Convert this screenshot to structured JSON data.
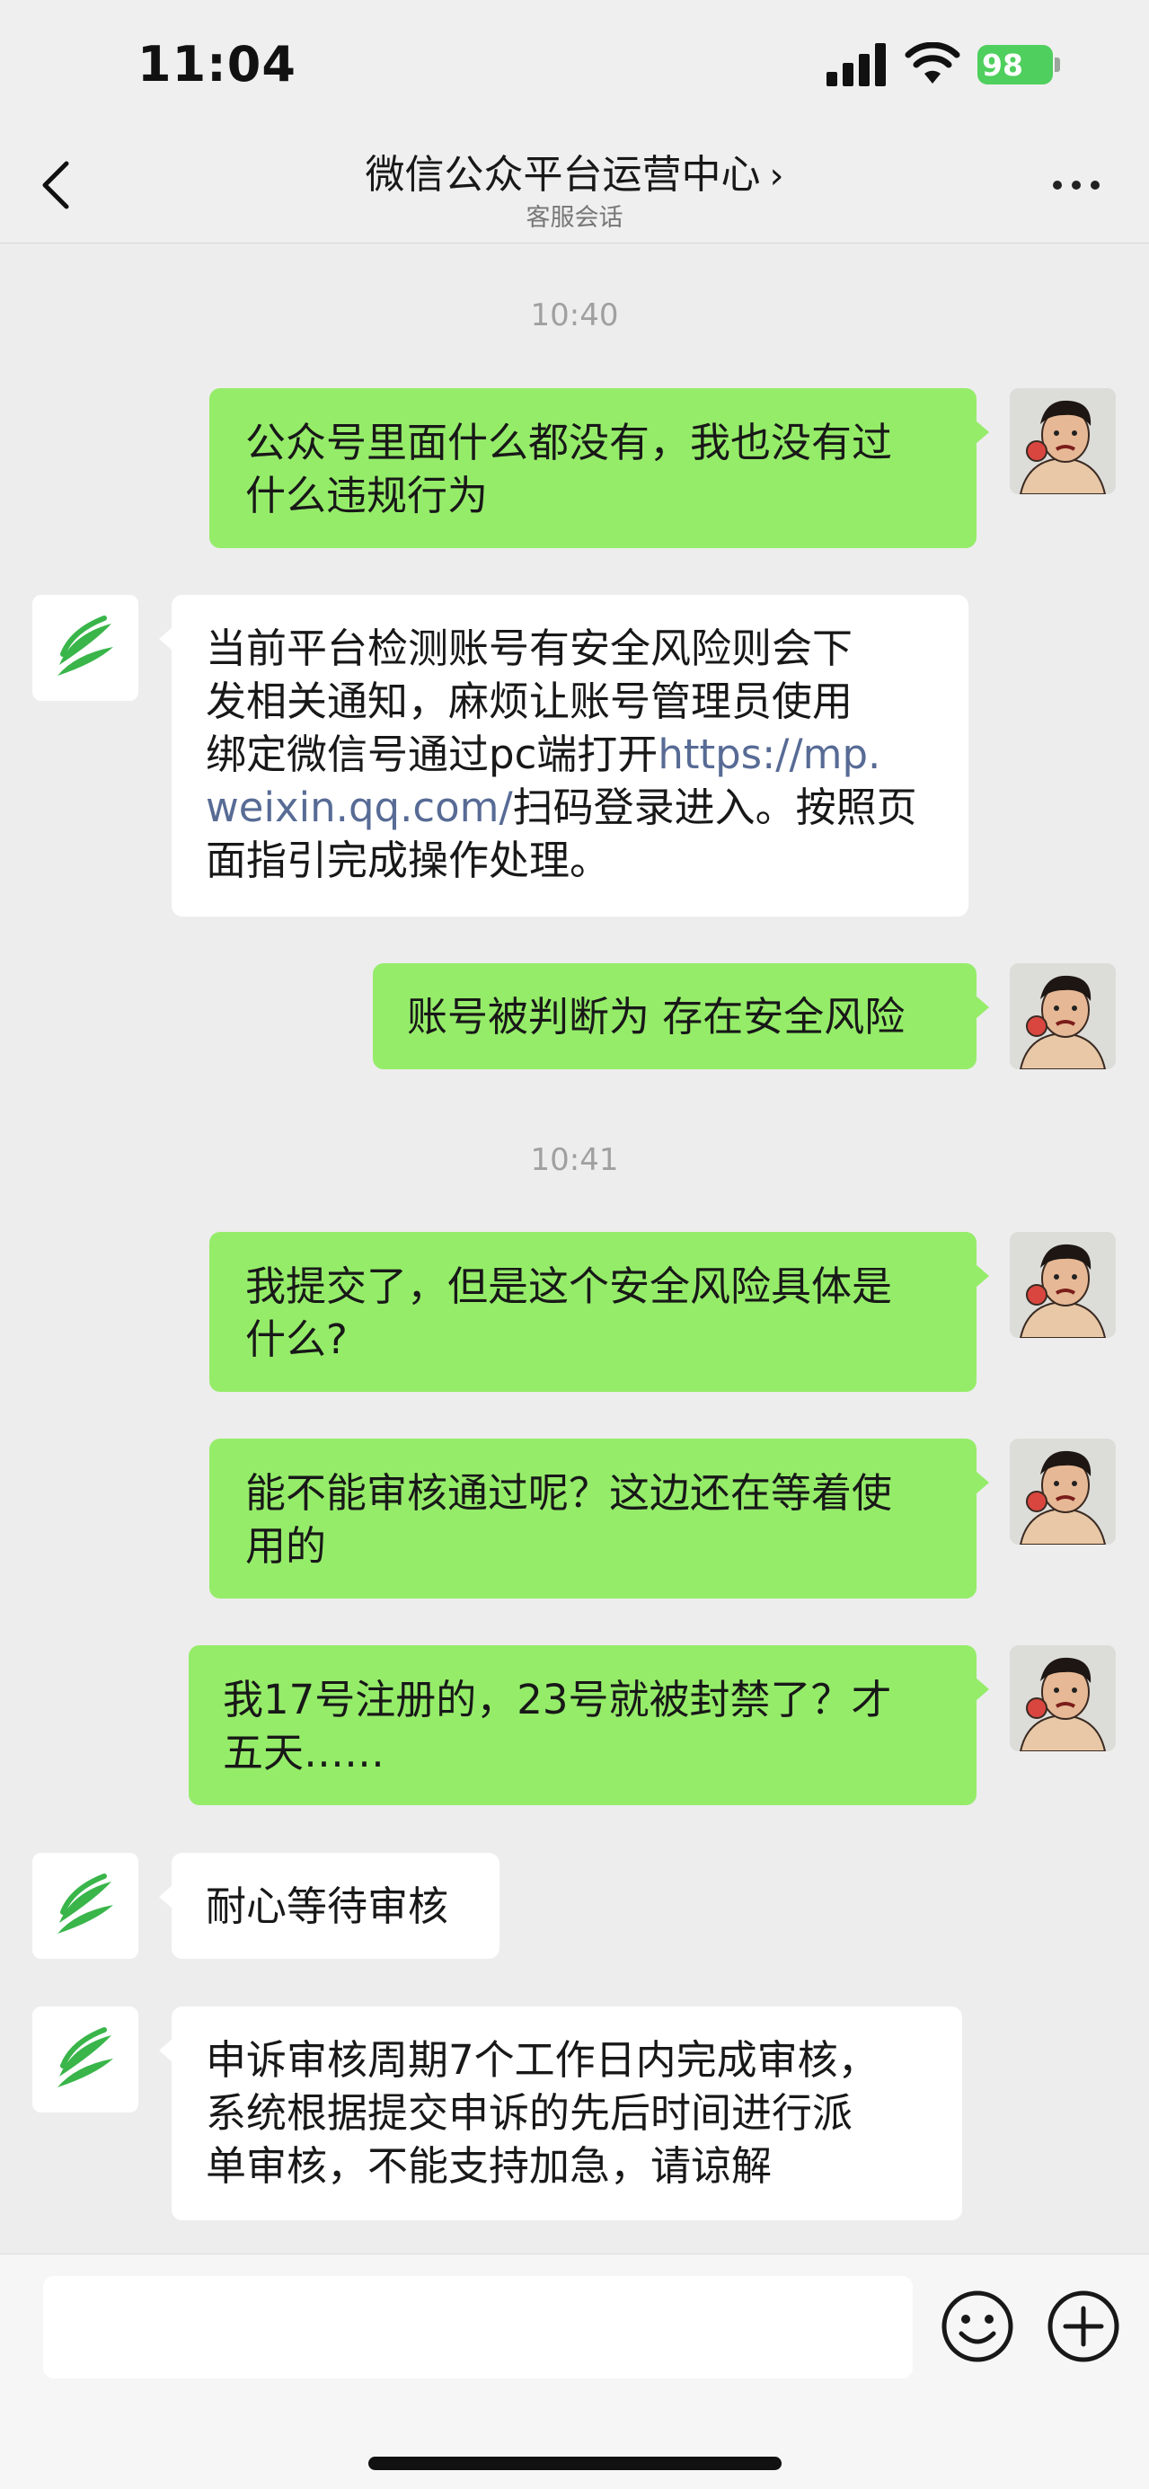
{
  "status_bar": {
    "time": "11:04",
    "battery": "98"
  },
  "header": {
    "title": "微信公众平台运营中心",
    "subtitle": "客服会话"
  },
  "timestamps": [
    "10:40",
    "10:41"
  ],
  "messages": [
    {
      "from": "me",
      "text": "公众号里面什么都没有，我也没有过\n什么违规行为"
    },
    {
      "from": "official",
      "text_before": "当前平台检测账号有安全风险则会下\n发相关通知，麻烦让账号管理员使用\n绑定微信号通过pc端打开",
      "link": "https://mp.\nweixin.qq.com/",
      "text_after": "扫码登录进入。按照页\n面指引完成操作处理。"
    },
    {
      "from": "me",
      "text": "账号被判断为 存在安全风险"
    },
    {
      "from": "me",
      "text": "我提交了，但是这个安全风险具体是\n什么?"
    },
    {
      "from": "me",
      "text": "能不能审核通过呢？这边还在等着使\n用的"
    },
    {
      "from": "me",
      "text": "我17号注册的，23号就被封禁了？才\n五天……"
    },
    {
      "from": "official",
      "text": "耐心等待审核"
    },
    {
      "from": "official",
      "text": "申诉审核周期7个工作日内完成审核，\n系统根据提交申诉的先后时间进行派\n单审核，不能支持加急，请谅解"
    }
  ],
  "input": {
    "value": ""
  },
  "colors": {
    "sent_bubble": "#95ec69",
    "received_bubble": "#ffffff",
    "link": "#576b95",
    "background": "#ededed"
  },
  "icons": {
    "official_avatar": "green-leaf-logo-icon",
    "emoji": "emoji-icon",
    "plus": "plus-icon",
    "back": "chevron-left-icon",
    "more": "more-dots-icon"
  }
}
